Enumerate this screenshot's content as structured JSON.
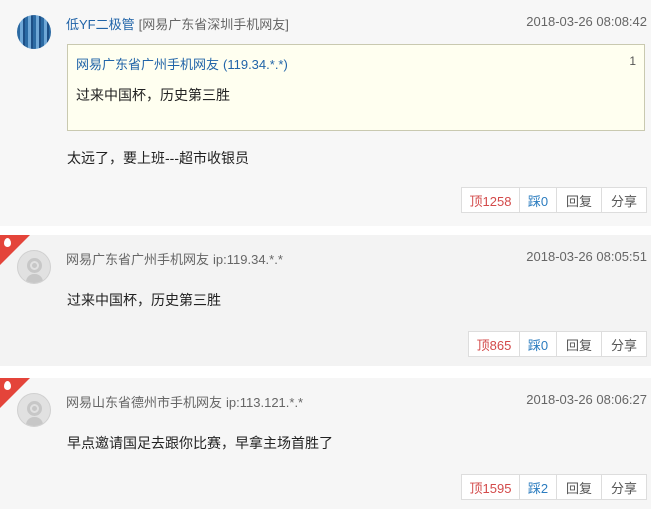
{
  "comments": [
    {
      "user": "低YF二极管",
      "location": "[网易广东省深圳手机网友]",
      "time": "2018-03-26 08:08:42",
      "quote": {
        "user": "网易广东省广州手机网友",
        "ip": "(119.34.*.*)",
        "floor": "1",
        "text": "过来中国杯，历史第三胜"
      },
      "text": "太远了，要上班---超市收银员",
      "actions": {
        "up": "顶1258",
        "down": "踩0",
        "reply": "回复",
        "share": "分享"
      }
    },
    {
      "location": "网易广东省广州手机网友",
      "ip": "ip:119.34.*.*",
      "time": "2018-03-26 08:05:51",
      "text": "过来中国杯，历史第三胜",
      "actions": {
        "up": "顶865",
        "down": "踩0",
        "reply": "回复",
        "share": "分享"
      }
    },
    {
      "location": "网易山东省德州市手机网友",
      "ip": "ip:113.121.*.*",
      "time": "2018-03-26 08:06:27",
      "text": "早点邀请国足去跟你比赛，早拿主场首胜了",
      "actions": {
        "up": "顶1595",
        "down": "踩2",
        "reply": "回复",
        "share": "分享"
      }
    }
  ],
  "colors": {
    "accent": "#2164a8",
    "hot_badge": "#e4443a",
    "up": "#d34a4a",
    "down": "#2b7cbf"
  }
}
